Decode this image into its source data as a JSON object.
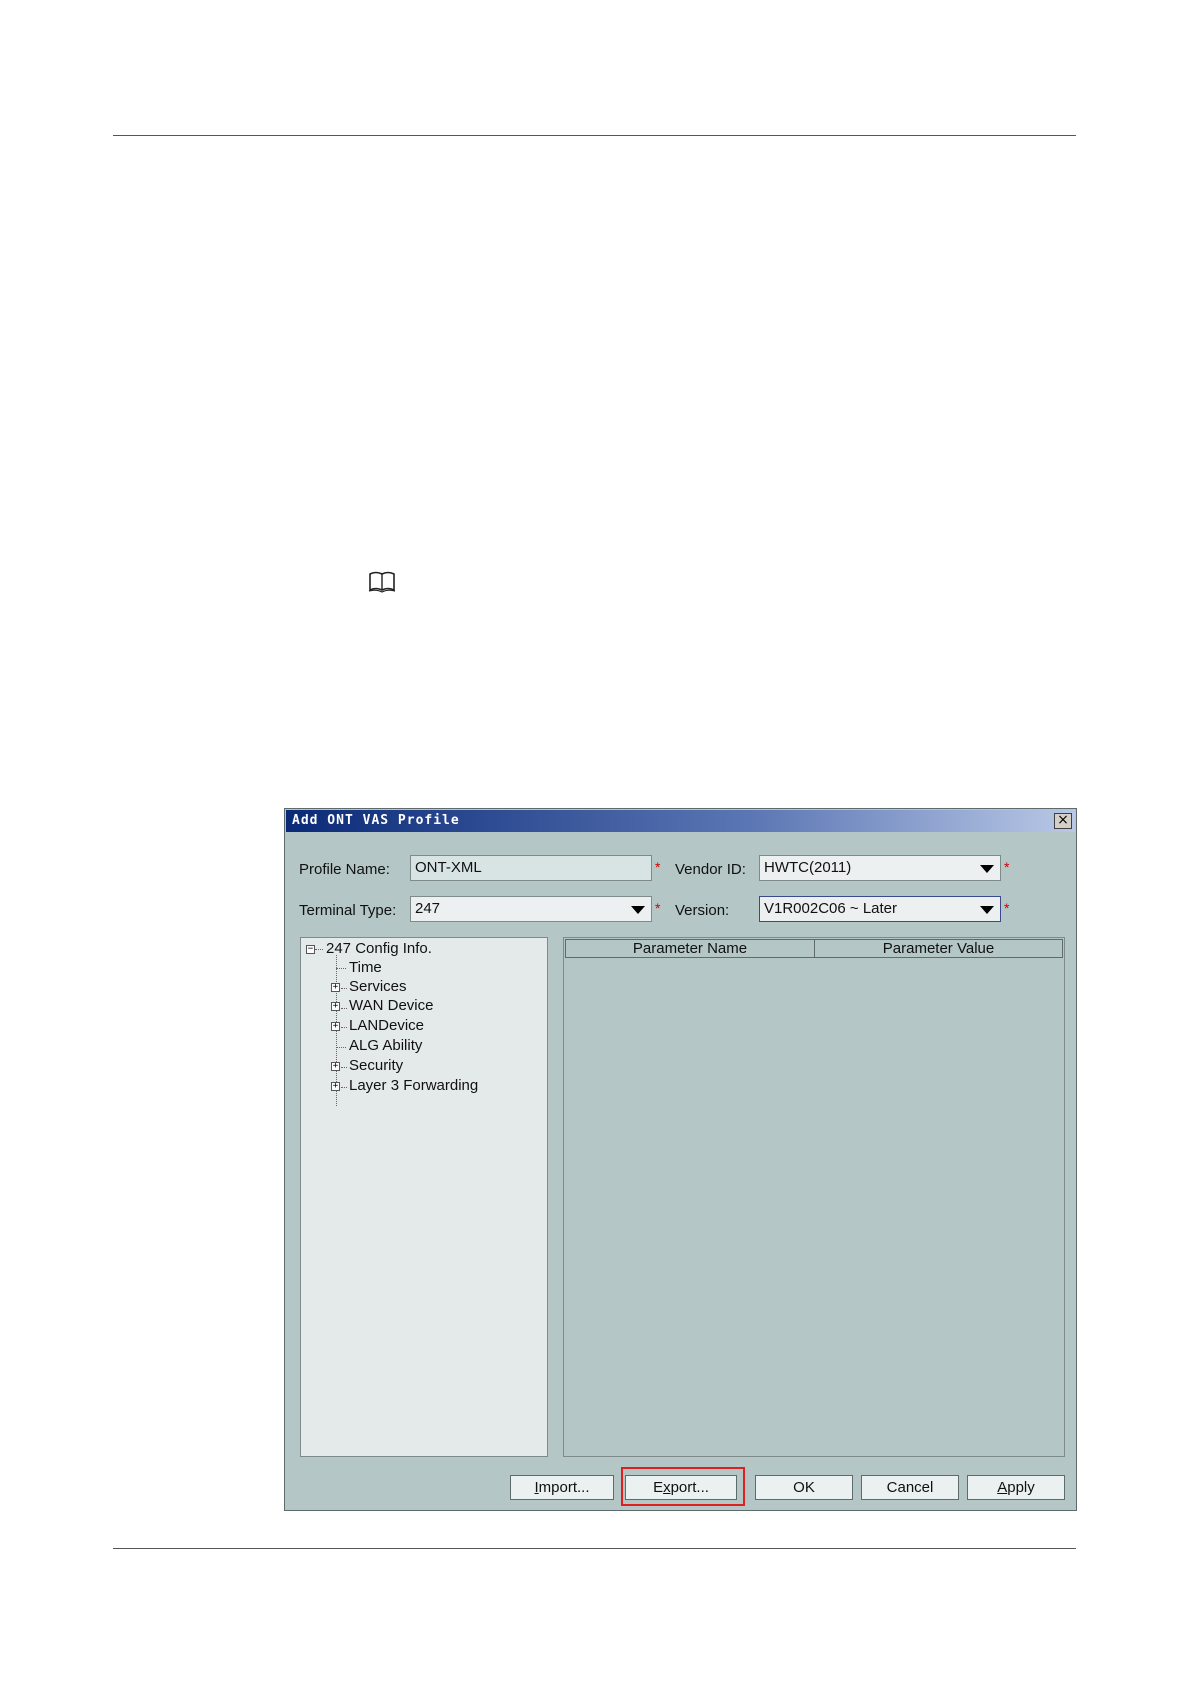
{
  "dialog": {
    "title": "Add ONT VAS Profile",
    "close_glyph": "×"
  },
  "form": {
    "profile_name_label": "Profile Name:",
    "profile_name_value": "ONT-XML",
    "vendor_id_label": "Vendor ID:",
    "vendor_id_value": "HWTC(2011)",
    "terminal_type_label": "Terminal Type:",
    "terminal_type_value": "247",
    "version_label": "Version:",
    "version_value": "V1R002C06 ~ Later",
    "required_mark": "*"
  },
  "tree": {
    "root": {
      "label": "247 Config Info.",
      "expander": "−"
    },
    "items": [
      {
        "label": "Time",
        "expander": ""
      },
      {
        "label": "Services",
        "expander": "+"
      },
      {
        "label": "WAN Device",
        "expander": "+"
      },
      {
        "label": "LANDevice",
        "expander": "+"
      },
      {
        "label": "ALG Ability",
        "expander": ""
      },
      {
        "label": "Security",
        "expander": "+"
      },
      {
        "label": "Layer 3 Forwarding",
        "expander": "+"
      }
    ]
  },
  "table": {
    "columns": [
      "Parameter Name",
      "Parameter Value"
    ],
    "rows": []
  },
  "buttons": {
    "import": {
      "mnemonic": "I",
      "rest": "mport..."
    },
    "export": {
      "pre": "E",
      "mnemonic": "x",
      "rest": "port..."
    },
    "ok": "OK",
    "cancel": "Cancel",
    "apply": {
      "mnemonic": "A",
      "rest": "pply"
    }
  },
  "colors": {
    "highlight": "#e02020",
    "required": "#d00000",
    "title_bar": "#0a2a78"
  }
}
